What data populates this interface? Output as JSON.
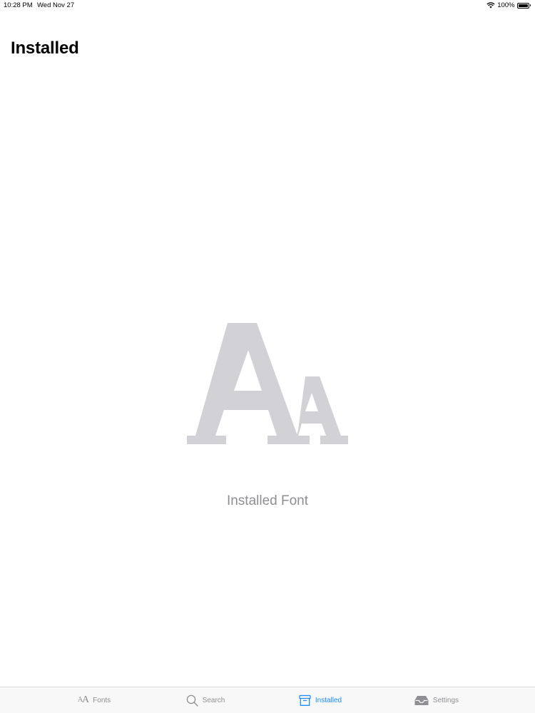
{
  "status_bar": {
    "time": "10:28 PM",
    "date": "Wed Nov 27",
    "battery": "100%",
    "battery_level": 1.0,
    "icons": [
      "wifi-icon",
      "battery-icon"
    ]
  },
  "page": {
    "title": "Installed"
  },
  "empty_state": {
    "icon": "font-aa-icon",
    "message": "Installed Font"
  },
  "tab_bar": {
    "tabs": [
      {
        "label": "Fonts",
        "icon": "font-aa-icon",
        "active": false
      },
      {
        "label": "Search",
        "icon": "search-icon",
        "active": false
      },
      {
        "label": "Installed",
        "icon": "archive-box-icon",
        "active": true
      },
      {
        "label": "Settings",
        "icon": "tray-icon",
        "active": false
      }
    ]
  },
  "colors": {
    "accent": "#1a8cff",
    "inactive": "#8e8e93",
    "illustration": "#d1d1d6",
    "tab_bar_bg": "#f8f8f8"
  }
}
